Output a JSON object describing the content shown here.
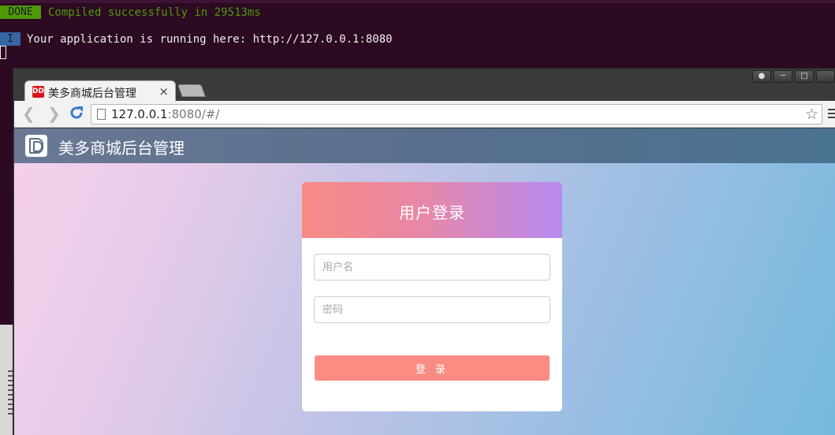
{
  "terminal": {
    "done_badge": "DONE",
    "done_message": "Compiled successfully in 29513ms",
    "info_badge": "I",
    "info_message": "Your application is running here: http://127.0.0.1:8080"
  },
  "browser": {
    "tab_title": "美多商城后台管理",
    "tab_favicon_text": "DD",
    "url_host": "127.0.0.1",
    "url_rest": ":8080/#/",
    "back_icon": "chevron-left-icon",
    "forward_icon": "chevron-right-icon",
    "reload_icon": "reload-icon",
    "star_icon": "star-icon",
    "menu_icon": "hamburger-menu-icon",
    "window_controls": [
      "user-icon",
      "minimize-icon",
      "maximize-icon",
      "close-icon"
    ]
  },
  "app": {
    "title": "美多商城后台管理",
    "logo_icon": "dd-logo-icon"
  },
  "login": {
    "heading": "用户登录",
    "username_placeholder": "用户名",
    "username_value": "",
    "password_placeholder": "密码",
    "password_value": "",
    "submit_label": "登 录"
  },
  "colors": {
    "terminal_bg": "#2c0a22",
    "done_green": "#4e9a06",
    "info_blue": "#3465a4",
    "header_bg": "#586f8c",
    "card_gradient_start": "#f78a84",
    "card_gradient_end": "#b78af2",
    "button_bg": "#fa8c84"
  }
}
